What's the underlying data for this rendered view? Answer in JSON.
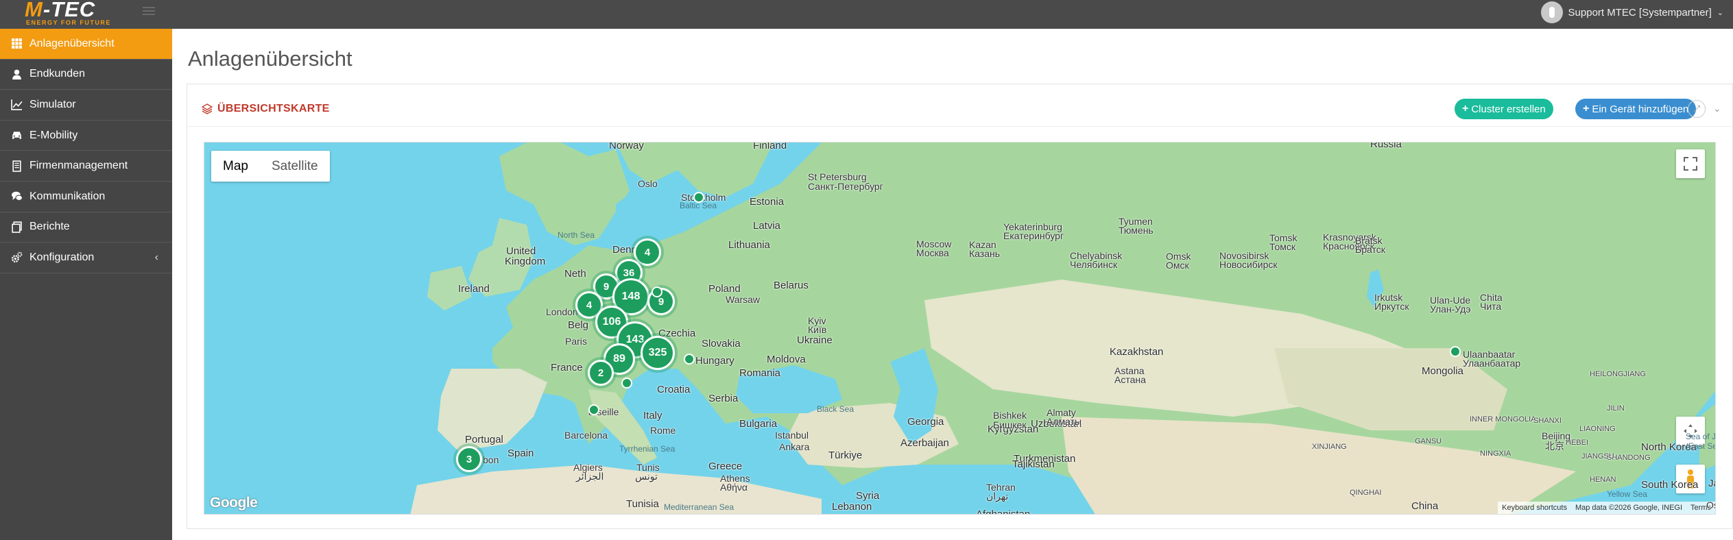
{
  "brand": {
    "name_prefix": "M",
    "name_suffix": "-TEC",
    "tagline": "ENERGY FOR FUTURE"
  },
  "user": {
    "name": "Support MTEC [Systempartner]"
  },
  "sidebar": {
    "items": [
      {
        "label": "Anlagenübersicht",
        "icon": "grid-icon",
        "active": true
      },
      {
        "label": "Endkunden",
        "icon": "user-icon"
      },
      {
        "label": "Simulator",
        "icon": "line-chart-icon"
      },
      {
        "label": "E-Mobility",
        "icon": "car-icon"
      },
      {
        "label": "Firmenmanagement",
        "icon": "building-icon"
      },
      {
        "label": "Kommunikation",
        "icon": "chat-icon"
      },
      {
        "label": "Berichte",
        "icon": "report-icon"
      },
      {
        "label": "Konfiguration",
        "icon": "gears-icon",
        "caret": "‹"
      }
    ]
  },
  "page": {
    "title": "Anlagenübersicht"
  },
  "card": {
    "title": "ÜBERSICHTSKARTE",
    "cluster_button": "Cluster erstellen",
    "add_button": "Ein Gerät hinzufügen"
  },
  "map": {
    "type_map": "Map",
    "type_satellite": "Satellite",
    "google": "Google",
    "attribution": {
      "shortcuts": "Keyboard shortcuts",
      "data": "Map data ©2026 Google, INEGI",
      "terms": "Terms"
    },
    "labels": [
      {
        "text": "Norway",
        "kind": "country"
      },
      {
        "text": "Finland",
        "kind": "country"
      },
      {
        "text": "Russia",
        "kind": "country"
      },
      {
        "text": "Oslo",
        "kind": "city"
      },
      {
        "text": "Stockholm",
        "kind": "city"
      },
      {
        "text": "Baltic Sea",
        "kind": "sea"
      },
      {
        "text": "St Petersburg",
        "kind": "city"
      },
      {
        "text": "Санкт-Петербург",
        "kind": "city"
      },
      {
        "text": "Estonia",
        "kind": "country"
      },
      {
        "text": "Latvia",
        "kind": "country"
      },
      {
        "text": "Lithuania",
        "kind": "country"
      },
      {
        "text": "North Sea",
        "kind": "sea"
      },
      {
        "text": "United",
        "kind": "country"
      },
      {
        "text": "Kingdom",
        "kind": "country"
      },
      {
        "text": "Ireland",
        "kind": "country"
      },
      {
        "text": "Denr",
        "kind": "country"
      },
      {
        "text": "Neth",
        "kind": "country"
      },
      {
        "text": "London",
        "kind": "city"
      },
      {
        "text": "Belg",
        "kind": "country"
      },
      {
        "text": "Paris",
        "kind": "city"
      },
      {
        "text": "France",
        "kind": "country"
      },
      {
        "text": "Poland",
        "kind": "country"
      },
      {
        "text": "Warsaw",
        "kind": "city"
      },
      {
        "text": "Belarus",
        "kind": "country"
      },
      {
        "text": "Czechia",
        "kind": "country"
      },
      {
        "text": "Slovakia",
        "kind": "country"
      },
      {
        "text": "Hungary",
        "kind": "country"
      },
      {
        "text": "Kyiv",
        "kind": "city"
      },
      {
        "text": "Київ",
        "kind": "city"
      },
      {
        "text": "Ukraine",
        "kind": "country"
      },
      {
        "text": "Moldova",
        "kind": "country"
      },
      {
        "text": "Romania",
        "kind": "country"
      },
      {
        "text": "Croatia",
        "kind": "country"
      },
      {
        "text": "Serbia",
        "kind": "country"
      },
      {
        "text": "Bulgaria",
        "kind": "country"
      },
      {
        "text": "Italy",
        "kind": "country"
      },
      {
        "text": "Rome",
        "kind": "city"
      },
      {
        "text": "arseille",
        "kind": "city"
      },
      {
        "text": "Barcelona",
        "kind": "city"
      },
      {
        "text": "Portugal",
        "kind": "country"
      },
      {
        "text": "Spain",
        "kind": "country"
      },
      {
        "text": "bon",
        "kind": "city"
      },
      {
        "text": "Tyrrhenian Sea",
        "kind": "sea"
      },
      {
        "text": "Greece",
        "kind": "country"
      },
      {
        "text": "Athens",
        "kind": "city"
      },
      {
        "text": "Αθήνα",
        "kind": "city"
      },
      {
        "text": "Istanbul",
        "kind": "city"
      },
      {
        "text": "Ankara",
        "kind": "city"
      },
      {
        "text": "Türkiye",
        "kind": "country"
      },
      {
        "text": "Black Sea",
        "kind": "sea"
      },
      {
        "text": "Algiers",
        "kind": "city"
      },
      {
        "text": "الجزائر",
        "kind": "city"
      },
      {
        "text": "Tunis",
        "kind": "city"
      },
      {
        "text": "تونس",
        "kind": "city"
      },
      {
        "text": "Tunisia",
        "kind": "country"
      },
      {
        "text": "Mediterranean Sea",
        "kind": "sea"
      },
      {
        "text": "Lebanon",
        "kind": "country"
      },
      {
        "text": "Syria",
        "kind": "country"
      },
      {
        "text": "Georgia",
        "kind": "country"
      },
      {
        "text": "Azerbaijan",
        "kind": "country"
      },
      {
        "text": "Tehran",
        "kind": "city"
      },
      {
        "text": "تهران",
        "kind": "city"
      },
      {
        "text": "Afghanistan",
        "kind": "country"
      },
      {
        "text": "Turkmenistan",
        "kind": "country"
      },
      {
        "text": "Uzbekistan",
        "kind": "country"
      },
      {
        "text": "Tajikistan",
        "kind": "country"
      },
      {
        "text": "Kyrgyzstan",
        "kind": "country"
      },
      {
        "text": "Bishkek",
        "kind": "city"
      },
      {
        "text": "Бишкек",
        "kind": "city"
      },
      {
        "text": "Almaty",
        "kind": "city"
      },
      {
        "text": "Алматы",
        "kind": "city"
      },
      {
        "text": "Kazakhstan",
        "kind": "country"
      },
      {
        "text": "Astana",
        "kind": "city"
      },
      {
        "text": "Астана",
        "kind": "city"
      },
      {
        "text": "Moscow",
        "kind": "city"
      },
      {
        "text": "Москва",
        "kind": "city"
      },
      {
        "text": "Kazan",
        "kind": "city"
      },
      {
        "text": "Казань",
        "kind": "city"
      },
      {
        "text": "Yekaterinburg",
        "kind": "city"
      },
      {
        "text": "Екатеринбург",
        "kind": "city"
      },
      {
        "text": "Chelyabinsk",
        "kind": "city"
      },
      {
        "text": "Челябинск",
        "kind": "city"
      },
      {
        "text": "Tyumen",
        "kind": "city"
      },
      {
        "text": "Тюмень",
        "kind": "city"
      },
      {
        "text": "Omsk",
        "kind": "city"
      },
      {
        "text": "Омск",
        "kind": "city"
      },
      {
        "text": "Novosibirsk",
        "kind": "city"
      },
      {
        "text": "Новосибирск",
        "kind": "city"
      },
      {
        "text": "Tomsk",
        "kind": "city"
      },
      {
        "text": "Томск",
        "kind": "city"
      },
      {
        "text": "Krasnoyarsk",
        "kind": "city"
      },
      {
        "text": "Красноярск",
        "kind": "city"
      },
      {
        "text": "Bratsk",
        "kind": "city"
      },
      {
        "text": "Братск",
        "kind": "city"
      },
      {
        "text": "Irkutsk",
        "kind": "city"
      },
      {
        "text": "Иркутск",
        "kind": "city"
      },
      {
        "text": "Ulan-Ude",
        "kind": "city"
      },
      {
        "text": "Улан-Удэ",
        "kind": "city"
      },
      {
        "text": "Chita",
        "kind": "city"
      },
      {
        "text": "Чита",
        "kind": "city"
      },
      {
        "text": "Ulaanbaatar",
        "kind": "city"
      },
      {
        "text": "Улаанбаатар",
        "kind": "city"
      },
      {
        "text": "Mongolia",
        "kind": "country"
      },
      {
        "text": "China",
        "kind": "country"
      },
      {
        "text": "XINJIANG",
        "kind": "small"
      },
      {
        "text": "QINGHAI",
        "kind": "small"
      },
      {
        "text": "GANSU",
        "kind": "small"
      },
      {
        "text": "INNER MONGOLIA",
        "kind": "small"
      },
      {
        "text": "HEILONGJIANG",
        "kind": "small"
      },
      {
        "text": "JILIN",
        "kind": "small"
      },
      {
        "text": "LIAONING",
        "kind": "small"
      },
      {
        "text": "NINGXIA",
        "kind": "small"
      },
      {
        "text": "SHANXI",
        "kind": "small"
      },
      {
        "text": "HEBEI",
        "kind": "small"
      },
      {
        "text": "SHANDONG",
        "kind": "small"
      },
      {
        "text": "HENAN",
        "kind": "small"
      },
      {
        "text": "JIANGSU",
        "kind": "small"
      },
      {
        "text": "Beijing",
        "kind": "city"
      },
      {
        "text": "北京",
        "kind": "city"
      },
      {
        "text": "North Korea",
        "kind": "country"
      },
      {
        "text": "South Korea",
        "kind": "country"
      },
      {
        "text": "Sea of Japan",
        "kind": "sea"
      },
      {
        "text": "(East Sea)",
        "kind": "sea"
      },
      {
        "text": "Yellow Sea",
        "kind": "sea"
      },
      {
        "text": "Ja",
        "kind": "country"
      },
      {
        "text": "Osak",
        "kind": "city"
      }
    ],
    "clusters": [
      {
        "count": "4"
      },
      {
        "count": "36"
      },
      {
        "count": "9"
      },
      {
        "count": "148"
      },
      {
        "count": "9"
      },
      {
        "count": "4"
      },
      {
        "count": "106"
      },
      {
        "count": "143"
      },
      {
        "count": "325"
      },
      {
        "count": "89"
      },
      {
        "count": "2"
      },
      {
        "count": "3"
      }
    ]
  }
}
